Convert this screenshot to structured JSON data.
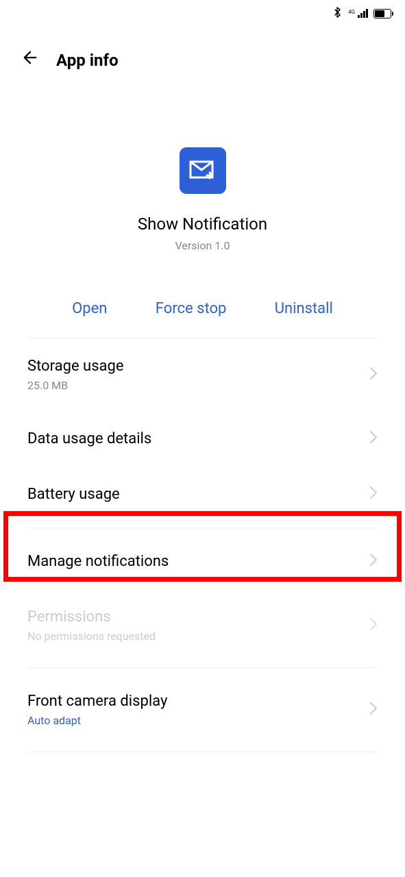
{
  "status_bar": {
    "network_label": "4G"
  },
  "header": {
    "title": "App info"
  },
  "app": {
    "name": "Show Notification",
    "version": "Version 1.0"
  },
  "actions": {
    "open": "Open",
    "force_stop": "Force stop",
    "uninstall": "Uninstall"
  },
  "settings": {
    "storage": {
      "title": "Storage usage",
      "subtitle": "25.0 MB"
    },
    "data_usage": {
      "title": "Data usage details"
    },
    "battery": {
      "title": "Battery usage"
    },
    "notifications": {
      "title": "Manage notifications"
    },
    "permissions": {
      "title": "Permissions",
      "subtitle": "No permissions requested"
    },
    "front_camera": {
      "title": "Front camera display",
      "subtitle": "Auto adapt"
    }
  }
}
